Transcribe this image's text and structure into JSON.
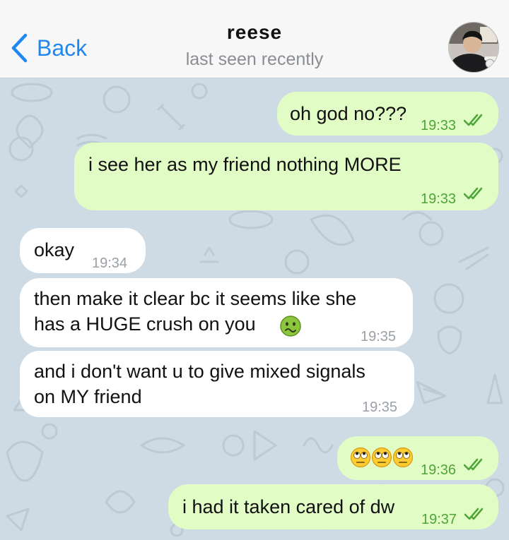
{
  "header": {
    "back_label": "Back",
    "contact_name": "reese",
    "status": "last seen recently"
  },
  "messages": [
    {
      "direction": "outgoing",
      "text": "oh god no???",
      "time": "19:33",
      "read": true
    },
    {
      "direction": "outgoing",
      "text": "i see her as my friend nothing MORE",
      "time": "19:33",
      "read": true
    },
    {
      "direction": "incoming",
      "text": "okay",
      "time": "19:34"
    },
    {
      "direction": "incoming",
      "lines": [
        "then make it clear bc it seems like she",
        "has a HUGE crush on you"
      ],
      "emoji": "nauseated-face-emoji",
      "time": "19:35"
    },
    {
      "direction": "incoming",
      "lines": [
        "and i don't want u to give mixed signals",
        "on MY friend"
      ],
      "time": "19:35"
    },
    {
      "direction": "outgoing",
      "emoji": "eye-roll-emoji x3",
      "time": "19:36",
      "read": true
    },
    {
      "direction": "outgoing",
      "text": "i had it taken cared of dw",
      "time": "19:37",
      "read": true
    }
  ],
  "colors": {
    "accent": "#1e87f0",
    "outgoing_bubble": "#e2fcc6",
    "incoming_bubble": "#ffffff",
    "read_check": "#4ea538",
    "chat_background": "#cfdbe4"
  }
}
